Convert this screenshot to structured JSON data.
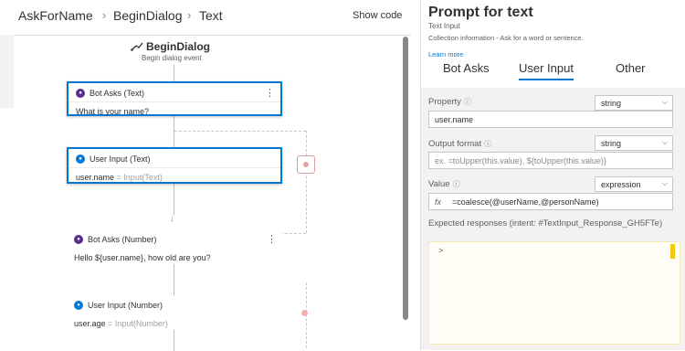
{
  "breadcrumb": {
    "items": [
      "AskForName",
      "BeginDialog",
      "Text"
    ],
    "separator": "›"
  },
  "toolbar": {
    "show_code": "Show code"
  },
  "canvas": {
    "trigger": {
      "title": "BeginDialog",
      "subtitle": "Begin dialog event"
    },
    "nodes": [
      {
        "header": "Bot Asks (Text)",
        "body": "What is your name?"
      },
      {
        "header": "User Input (Text)",
        "body_key": "user.name",
        "body_value": "= Input(Text)"
      },
      {
        "header": "Bot Asks (Number)",
        "body": "Hello ${user.name}, how old are you?"
      },
      {
        "header": "User Input (Number)",
        "body_key": "user.age",
        "body_value": "= Input(Number)"
      }
    ]
  },
  "panel": {
    "title": "Prompt for text",
    "subtitle": "Text Input",
    "description": "Collection information - Ask for a word or sentence.",
    "learn_more": "Learn more",
    "tabs": [
      "Bot Asks",
      "User Input",
      "Other"
    ],
    "active_tab": "User Input",
    "fields": {
      "property": {
        "label": "Property",
        "value": "user.name",
        "type": "string"
      },
      "output_format": {
        "label": "Output format",
        "placeholder": "ex. =toUpper(this.value), ${toUpper(this.value)}",
        "type": "string"
      },
      "value": {
        "label": "Value",
        "fx": "fx",
        "value": "=coalesce(@userName,@personName)",
        "type": "expression"
      },
      "expected": {
        "label": "Expected responses (intent: #TextInput_Response_GH5FTe)",
        "content": ">"
      }
    }
  },
  "colors": {
    "accent": "#0078d4",
    "bot_badge": "#5c2d91",
    "user_badge": "#0078d4"
  }
}
